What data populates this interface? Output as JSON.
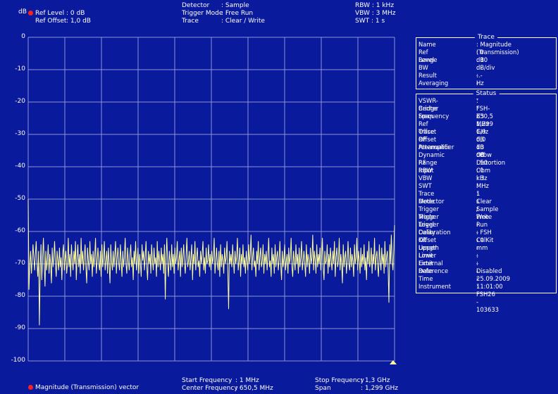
{
  "header": {
    "unit": "dB",
    "ref_level_label": "Ref Level",
    "ref_level_value": ": 0   dB",
    "ref_offset_label": "Ref Offset",
    "ref_offset_value": ": 1,0 dB",
    "detector_label": "Detector",
    "detector_value": ": Sample",
    "trigger_mode_label": "Trigger Mode",
    "trigger_mode_value": ": Free Run",
    "trace_label": "Trace",
    "trace_value": ": Clear / Write",
    "rbw": "RBW : 1 kHz",
    "vbw": "VBW : 3 MHz",
    "swt": "SWT : 1 s"
  },
  "y_axis_ticks": [
    "0",
    "-10",
    "-20",
    "-30",
    "-40",
    "-50",
    "-60",
    "-70",
    "-80",
    "-90",
    "-100"
  ],
  "footer": {
    "trace_name": "Magnitude (Transmission) vector",
    "start_frequency_label": "Start Frequency",
    "start_frequency_value": ":    1   MHz",
    "center_frequency_label": "Center Frequency",
    "center_frequency_value": ": 650,5 MHz",
    "stop_frequency_label": "Stop Frequency",
    "stop_frequency_value": ": 1,3    GHz",
    "span_label": "Span",
    "span_value": ": 1,299 GHz"
  },
  "trace_panel": {
    "title": "Trace",
    "rows": [
      {
        "k": "Name",
        "v": ": Magnitude (Transmission)"
      },
      {
        "k": "Ref Level",
        "v": ":     0      dB"
      },
      {
        "k": "Range",
        "v": ": 10 dB/div"
      },
      {
        "k": "BW",
        "v": ": --.-          Hz"
      },
      {
        "k": "Result",
        "v": ": - - -"
      },
      {
        "k": "Averaging",
        "v": ": - - -"
      }
    ]
  },
  "status_panel": {
    "title": "Status",
    "rows": [
      {
        "k": "VSWR-Bridge",
        "v": ": FSH-Z3"
      },
      {
        "k": "Center Frequency",
        "v": ": 650,5      MHz"
      },
      {
        "k": "Span",
        "v": ":    1,299 GHz"
      },
      {
        "k": "Ref Offset",
        "v": ":     1,0     dB"
      },
      {
        "k": "Trace Offset",
        "v": ":     0,0     dB"
      },
      {
        "k": "RF Attenuator",
        "v": ":     10      dB"
      },
      {
        "k": "Preamplifier",
        "v": ": Off"
      },
      {
        "k": "Dynamic Range",
        "v": ": Low Distortion"
      },
      {
        "k": "RF Input",
        "v": ":     50      Ohm"
      },
      {
        "k": "RBW",
        "v": ":      1      kHz"
      },
      {
        "k": "VBW",
        "v": ":      3      MHz"
      },
      {
        "k": "SWT",
        "v": ":      1      s"
      },
      {
        "k": "Trace Mode",
        "v": ": Clear / Write"
      },
      {
        "k": "Detector",
        "v": ": Sample"
      },
      {
        "k": "Trigger Mode",
        "v": ": Free Run"
      },
      {
        "k": "Trigger Level",
        "v": ": - - -"
      },
      {
        "k": "Trigger Delay",
        "v": ": - - -"
      },
      {
        "k": "Calibration Kit",
        "v": ": FSH CalKit"
      },
      {
        "k": "Offset Length",
        "v": ":      0      mm"
      },
      {
        "k": "Upper Limit",
        "v": ": - - -"
      },
      {
        "k": "Lower Limit",
        "v": ": - - -"
      },
      {
        "k": "External Reference",
        "v": ": Disabled"
      },
      {
        "k": "Date",
        "v": ": 25.09.2009"
      },
      {
        "k": "Time",
        "v": ": 11:01:00"
      },
      {
        "k": "Instrument",
        "v": ": FSH26 - 103633"
      }
    ]
  },
  "colors": {
    "background": "#0a1a9c",
    "grid": "#8a93d6",
    "trace": "#ffff99",
    "marker": "#ff2020"
  },
  "trace_samples_db": [
    -50,
    -78,
    -70,
    -66,
    -73,
    -69,
    -64,
    -68,
    -72,
    -67,
    -63,
    -70,
    -74,
    -66,
    -89,
    -71,
    -64,
    -75,
    -68,
    -62,
    -70,
    -77,
    -66,
    -72,
    -69,
    -64,
    -73,
    -67,
    -70,
    -76,
    -65,
    -71,
    -68,
    -63,
    -70,
    -74,
    -66,
    -69,
    -72,
    -65,
    -71,
    -68,
    -75,
    -67,
    -64,
    -72,
    -69,
    -66,
    -73,
    -70,
    -62,
    -71,
    -67,
    -74,
    -64,
    -69,
    -72,
    -66,
    -70,
    -63,
    -75,
    -68,
    -64,
    -71,
    -67,
    -73,
    -62,
    -70,
    -66,
    -72,
    -68,
    -64,
    -71,
    -76,
    -65,
    -69,
    -72,
    -63,
    -70,
    -67,
    -74,
    -66,
    -71,
    -68,
    -62,
    -73,
    -69,
    -65,
    -70,
    -72,
    -66,
    -74,
    -64,
    -71,
    -68,
    -63,
    -72,
    -69,
    -66,
    -73,
    -65,
    -70,
    -76,
    -64,
    -69,
    -72,
    -66,
    -71,
    -67,
    -63,
    -73,
    -68,
    -65,
    -70,
    -72,
    -64,
    -69,
    -74,
    -66,
    -71,
    -68,
    -62,
    -70,
    -73,
    -65,
    -69,
    -72,
    -67,
    -64,
    -71,
    -68,
    -75,
    -66,
    -70,
    -63,
    -72,
    -69,
    -65,
    -73,
    -67,
    -70,
    -74,
    -64,
    -69,
    -66,
    -72,
    -68,
    -63,
    -71,
    -75,
    -66,
    -70,
    -67,
    -73,
    -64,
    -69,
    -72,
    -65,
    -70,
    -68,
    -74,
    -63,
    -71,
    -66,
    -69,
    -72,
    -65,
    -70,
    -67,
    -73,
    -64,
    -81,
    -68,
    -62,
    -70,
    -74,
    -66,
    -69,
    -72,
    -64,
    -71,
    -67,
    -73,
    -65,
    -70,
    -68,
    -63,
    -72,
    -69,
    -66,
    -74,
    -65,
    -71,
    -68,
    -64,
    -70,
    -73,
    -67,
    -62,
    -71,
    -69,
    -66,
    -72,
    -68,
    -64,
    -75,
    -67,
    -70,
    -63,
    -72,
    -68,
    -65,
    -71,
    -69,
    -74,
    -66,
    -70,
    -67,
    -63,
    -72,
    -68,
    -73,
    -65,
    -70,
    -69,
    -64,
    -71,
    -67,
    -72,
    -66,
    -70,
    -68,
    -62,
    -73,
    -69,
    -65,
    -70,
    -72,
    -66,
    -74,
    -64,
    -71,
    -67,
    -69,
    -73,
    -65,
    -70,
    -68,
    -63,
    -72,
    -84,
    -66,
    -70,
    -67,
    -71,
    -64,
    -69,
    -73,
    -66,
    -70,
    -68,
    -62,
    -72,
    -69,
    -65,
    -74,
    -67,
    -70,
    -64,
    -71,
    -68,
    -73,
    -66,
    -69,
    -72,
    -64,
    -70,
    -67,
    -61,
    -72,
    -68,
    -65,
    -71,
    -69,
    -74,
    -66,
    -70,
    -63,
    -72,
    -68,
    -65,
    -71,
    -69,
    -64,
    -73,
    -67,
    -70,
    -66,
    -72,
    -68,
    -62,
    -71,
    -69,
    -74,
    -65,
    -70,
    -67,
    -73,
    -64,
    -71,
    -68,
    -66,
    -72,
    -69,
    -63,
    -70,
    -75,
    -66,
    -71,
    -68,
    -64,
    -72,
    -69,
    -67,
    -73,
    -65,
    -70,
    -68,
    -62,
    -71,
    -74,
    -66,
    -69,
    -72,
    -64,
    -70,
    -67,
    -73,
    -65,
    -71,
    -68,
    -63,
    -72,
    -69,
    -66,
    -70,
    -74,
    -64,
    -71,
    -67,
    -69,
    -73,
    -65,
    -70,
    -68,
    -61,
    -72,
    -66,
    -69,
    -73,
    -64,
    -71,
    -67,
    -70,
    -65,
    -72,
    -68,
    -62,
    -71,
    -75,
    -66,
    -70,
    -69,
    -64,
    -73,
    -67,
    -71,
    -65,
    -69,
    -72,
    -66,
    -70,
    -63,
    -74,
    -68,
    -65,
    -71,
    -69,
    -62,
    -72,
    -67,
    -70,
    -76,
    -64,
    -71,
    -68,
    -66,
    -73,
    -69,
    -63,
    -70,
    -72,
    -65,
    -71,
    -67,
    -69,
    -74,
    -64,
    -70,
    -68,
    -62,
    -72,
    -66,
    -69,
    -73,
    -65,
    -71,
    -67,
    -70,
    -64,
    -72,
    -68,
    -75,
    -66,
    -70,
    -63,
    -71,
    -69,
    -65,
    -73,
    -67,
    -70,
    -62,
    -72,
    -68,
    -66,
    -71,
    -74,
    -64,
    -69,
    -72,
    -65,
    -70,
    -67,
    -73,
    -63,
    -71,
    -68,
    -66,
    -72,
    -82,
    -64,
    -70,
    -61,
    -69,
    -72,
    -66,
    -58
  ]
}
